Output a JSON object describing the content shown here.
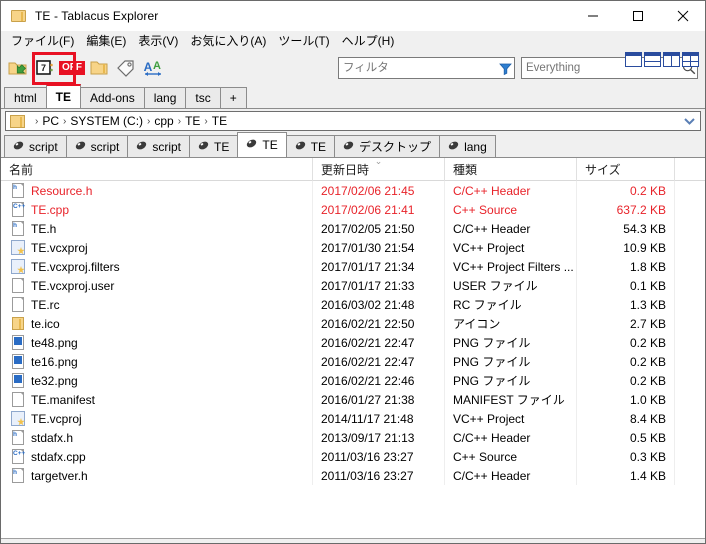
{
  "window": {
    "title": "TE - Tablacus Explorer",
    "icon": "folder-icon",
    "controls": {
      "minimize": "minimize-icon",
      "maximize": "maximize-icon",
      "close": "close-icon"
    }
  },
  "menubar": {
    "items": [
      {
        "label": "ファイル(F)",
        "accel": "F"
      },
      {
        "label": "編集(E)",
        "accel": "E"
      },
      {
        "label": "表示(V)",
        "accel": "V"
      },
      {
        "label": "お気に入り(A)",
        "accel": "A"
      },
      {
        "label": "ツール(T)",
        "accel": "T"
      },
      {
        "label": "ヘルプ(H)",
        "accel": "H"
      }
    ]
  },
  "toolbar": {
    "icons": [
      {
        "name": "open-folder-icon"
      },
      {
        "name": "seven-zip-icon"
      },
      {
        "name": "off-toggle-icon",
        "label": "OFF"
      },
      {
        "name": "folder-icon"
      },
      {
        "name": "tag-icon"
      },
      {
        "name": "font-size-icon"
      }
    ],
    "highlight": {
      "target": "off-toggle-icon",
      "color": "#e81123"
    },
    "filter": {
      "placeholder": "フィルタ",
      "value": "",
      "icon": "filter-funnel-icon"
    },
    "everything": {
      "placeholder": "Everything",
      "value": "",
      "icon": "search-icon"
    }
  },
  "layout_buttons": [
    {
      "name": "layout-single"
    },
    {
      "name": "layout-horizontal-split"
    },
    {
      "name": "layout-vertical-split"
    },
    {
      "name": "layout-quad"
    }
  ],
  "toptabs": {
    "items": [
      {
        "label": "html",
        "active": false
      },
      {
        "label": "TE",
        "active": true
      },
      {
        "label": "Add-ons",
        "active": false
      },
      {
        "label": "lang",
        "active": false
      },
      {
        "label": "tsc",
        "active": false
      },
      {
        "label": "+",
        "active": false
      }
    ]
  },
  "breadcrumb": {
    "segments": [
      "PC",
      "SYSTEM (C:)",
      "cpp",
      "TE",
      "TE"
    ],
    "separator": "›",
    "dropdown": "chevron-down-icon"
  },
  "subtabs": {
    "items": [
      {
        "label": "script",
        "active": false
      },
      {
        "label": "script",
        "active": false
      },
      {
        "label": "script",
        "active": false
      },
      {
        "label": "TE",
        "active": false
      },
      {
        "label": "TE",
        "active": true
      },
      {
        "label": "TE",
        "active": false
      },
      {
        "label": "デスクトップ",
        "active": false
      },
      {
        "label": "lang",
        "active": false
      }
    ]
  },
  "filelist": {
    "columns": [
      {
        "key": "name",
        "label": "名前",
        "sorted": false
      },
      {
        "key": "date",
        "label": "更新日時",
        "sorted": true,
        "sortmark": "⌄"
      },
      {
        "key": "type",
        "label": "種類",
        "sorted": false
      },
      {
        "key": "size",
        "label": "サイズ",
        "sorted": false
      }
    ],
    "rows": [
      {
        "name": "Resource.h",
        "date": "2017/02/06 21:45",
        "type": "C/C++ Header",
        "size": "0.2 KB",
        "icon": "h-file-icon",
        "red": true
      },
      {
        "name": "TE.cpp",
        "date": "2017/02/06 21:41",
        "type": "C++ Source",
        "size": "637.2 KB",
        "icon": "cpp-file-icon",
        "red": true
      },
      {
        "name": "TE.h",
        "date": "2017/02/05 21:50",
        "type": "C/C++ Header",
        "size": "54.3 KB",
        "icon": "h-file-icon",
        "red": false
      },
      {
        "name": "TE.vcxproj",
        "date": "2017/01/30 21:54",
        "type": "VC++ Project",
        "size": "10.9 KB",
        "icon": "vcxproj-file-icon",
        "red": false
      },
      {
        "name": "TE.vcxproj.filters",
        "date": "2017/01/17 21:34",
        "type": "VC++ Project Filters ...",
        "size": "1.8 KB",
        "icon": "vcxproj-file-icon",
        "red": false
      },
      {
        "name": "TE.vcxproj.user",
        "date": "2017/01/17 21:33",
        "type": "USER ファイル",
        "size": "0.1 KB",
        "icon": "blank-file-icon",
        "red": false
      },
      {
        "name": "TE.rc",
        "date": "2016/03/02 21:48",
        "type": "RC ファイル",
        "size": "1.3 KB",
        "icon": "blank-file-icon",
        "red": false
      },
      {
        "name": "te.ico",
        "date": "2016/02/21 22:50",
        "type": "アイコン",
        "size": "2.7 KB",
        "icon": "ico-file-icon",
        "red": false
      },
      {
        "name": "te48.png",
        "date": "2016/02/21 22:47",
        "type": "PNG ファイル",
        "size": "0.2 KB",
        "icon": "png-file-icon",
        "red": false
      },
      {
        "name": "te16.png",
        "date": "2016/02/21 22:47",
        "type": "PNG ファイル",
        "size": "0.2 KB",
        "icon": "png-file-icon",
        "red": false
      },
      {
        "name": "te32.png",
        "date": "2016/02/21 22:46",
        "type": "PNG ファイル",
        "size": "0.2 KB",
        "icon": "png-file-icon",
        "red": false
      },
      {
        "name": "TE.manifest",
        "date": "2016/01/27 21:38",
        "type": "MANIFEST ファイル",
        "size": "1.0 KB",
        "icon": "blank-file-icon",
        "red": false
      },
      {
        "name": "TE.vcproj",
        "date": "2014/11/17 21:48",
        "type": "VC++ Project",
        "size": "8.4 KB",
        "icon": "vcproj-file-icon",
        "red": false
      },
      {
        "name": "stdafx.h",
        "date": "2013/09/17 21:13",
        "type": "C/C++ Header",
        "size": "0.5 KB",
        "icon": "h-file-icon",
        "red": false
      },
      {
        "name": "stdafx.cpp",
        "date": "2011/03/16 23:27",
        "type": "C++ Source",
        "size": "0.3 KB",
        "icon": "cpp-file-icon",
        "red": false
      },
      {
        "name": "targetver.h",
        "date": "2011/03/16 23:27",
        "type": "C/C++ Header",
        "size": "1.4 KB",
        "icon": "h-file-icon",
        "red": false
      }
    ]
  },
  "colors": {
    "highlight_red": "#e81123",
    "row_red": "#e8232a",
    "window_bg": "#f0f0f0",
    "list_bg": "#ffffff"
  }
}
